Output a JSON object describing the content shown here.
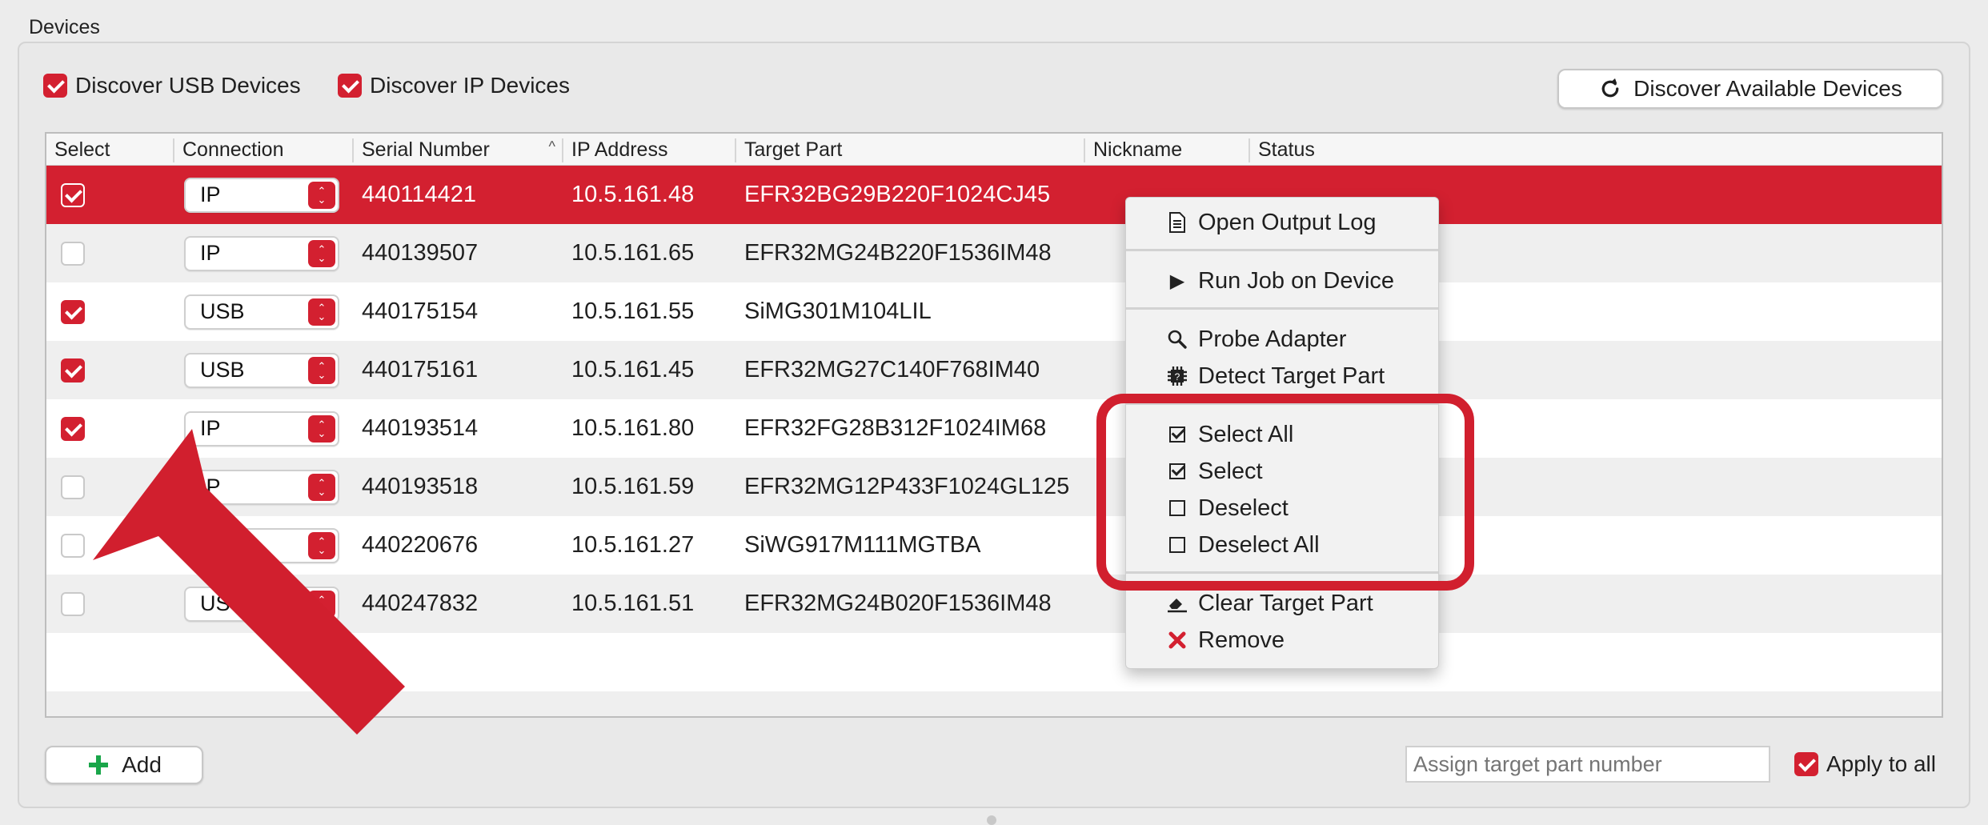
{
  "group_title": "Devices",
  "discover_usb": {
    "label": "Discover USB Devices",
    "checked": true
  },
  "discover_ip": {
    "label": "Discover IP Devices",
    "checked": true
  },
  "discover_button": {
    "label": "Discover Available Devices",
    "icon": "refresh-icon"
  },
  "columns": [
    "Select",
    "Connection",
    "Serial Number",
    "IP Address",
    "Target Part",
    "Nickname",
    "Status"
  ],
  "rows": [
    {
      "checked": true,
      "connection": "IP",
      "serial": "440114421",
      "ip": "10.5.161.48",
      "target": "EFR32BG29B220F1024CJ45",
      "selected": true
    },
    {
      "checked": false,
      "connection": "IP",
      "serial": "440139507",
      "ip": "10.5.161.65",
      "target": "EFR32MG24B220F1536IM48"
    },
    {
      "checked": true,
      "connection": "USB",
      "serial": "440175154",
      "ip": "10.5.161.55",
      "target": "SiMG301M104LIL"
    },
    {
      "checked": true,
      "connection": "USB",
      "serial": "440175161",
      "ip": "10.5.161.45",
      "target": "EFR32MG27C140F768IM40"
    },
    {
      "checked": true,
      "connection": "IP",
      "serial": "440193514",
      "ip": "10.5.161.80",
      "target": "EFR32FG28B312F1024IM68"
    },
    {
      "checked": false,
      "connection": "IP",
      "serial": "440193518",
      "ip": "10.5.161.59",
      "target": "EFR32MG12P433F1024GL125"
    },
    {
      "checked": false,
      "connection": "",
      "serial": "440220676",
      "ip": "10.5.161.27",
      "target": "SiWG917M111MGTBA"
    },
    {
      "checked": false,
      "connection": "US",
      "serial": "440247832",
      "ip": "10.5.161.51",
      "target": "EFR32MG24B020F1536IM48"
    }
  ],
  "menu": {
    "open_log": "Open Output Log",
    "run_job": "Run Job on Device",
    "probe": "Probe Adapter",
    "detect": "Detect Target Part",
    "select_all": "Select All",
    "select": "Select",
    "deselect": "Deselect",
    "deselect_all": "Deselect All",
    "clear": "Clear Target Part",
    "remove": "Remove"
  },
  "add_button": "Add",
  "assign_placeholder": "Assign target part number",
  "apply_to_all": {
    "label": "Apply to all",
    "checked": true
  },
  "colors": {
    "accent": "#d32030",
    "annotation": "#d11f2e"
  }
}
